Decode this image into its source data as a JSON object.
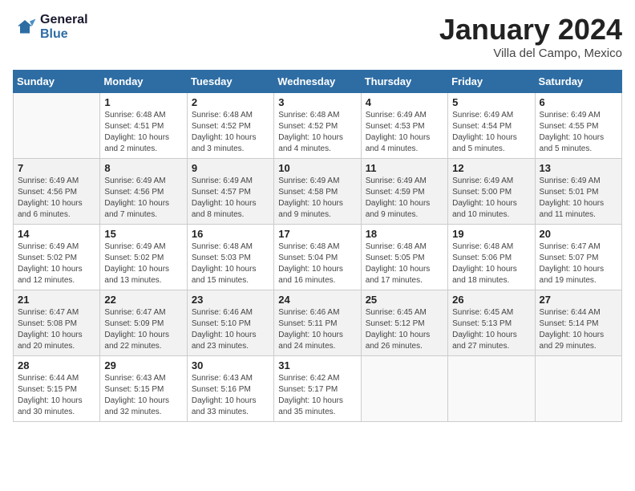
{
  "logo": {
    "line1": "General",
    "line2": "Blue"
  },
  "title": "January 2024",
  "subtitle": "Villa del Campo, Mexico",
  "days_of_week": [
    "Sunday",
    "Monday",
    "Tuesday",
    "Wednesday",
    "Thursday",
    "Friday",
    "Saturday"
  ],
  "weeks": [
    [
      {
        "day": "",
        "info": ""
      },
      {
        "day": "1",
        "info": "Sunrise: 6:48 AM\nSunset: 4:51 PM\nDaylight: 10 hours\nand 2 minutes."
      },
      {
        "day": "2",
        "info": "Sunrise: 6:48 AM\nSunset: 4:52 PM\nDaylight: 10 hours\nand 3 minutes."
      },
      {
        "day": "3",
        "info": "Sunrise: 6:48 AM\nSunset: 4:52 PM\nDaylight: 10 hours\nand 4 minutes."
      },
      {
        "day": "4",
        "info": "Sunrise: 6:49 AM\nSunset: 4:53 PM\nDaylight: 10 hours\nand 4 minutes."
      },
      {
        "day": "5",
        "info": "Sunrise: 6:49 AM\nSunset: 4:54 PM\nDaylight: 10 hours\nand 5 minutes."
      },
      {
        "day": "6",
        "info": "Sunrise: 6:49 AM\nSunset: 4:55 PM\nDaylight: 10 hours\nand 5 minutes."
      }
    ],
    [
      {
        "day": "7",
        "info": "Sunrise: 6:49 AM\nSunset: 4:56 PM\nDaylight: 10 hours\nand 6 minutes."
      },
      {
        "day": "8",
        "info": "Sunrise: 6:49 AM\nSunset: 4:56 PM\nDaylight: 10 hours\nand 7 minutes."
      },
      {
        "day": "9",
        "info": "Sunrise: 6:49 AM\nSunset: 4:57 PM\nDaylight: 10 hours\nand 8 minutes."
      },
      {
        "day": "10",
        "info": "Sunrise: 6:49 AM\nSunset: 4:58 PM\nDaylight: 10 hours\nand 9 minutes."
      },
      {
        "day": "11",
        "info": "Sunrise: 6:49 AM\nSunset: 4:59 PM\nDaylight: 10 hours\nand 9 minutes."
      },
      {
        "day": "12",
        "info": "Sunrise: 6:49 AM\nSunset: 5:00 PM\nDaylight: 10 hours\nand 10 minutes."
      },
      {
        "day": "13",
        "info": "Sunrise: 6:49 AM\nSunset: 5:01 PM\nDaylight: 10 hours\nand 11 minutes."
      }
    ],
    [
      {
        "day": "14",
        "info": "Sunrise: 6:49 AM\nSunset: 5:02 PM\nDaylight: 10 hours\nand 12 minutes."
      },
      {
        "day": "15",
        "info": "Sunrise: 6:49 AM\nSunset: 5:02 PM\nDaylight: 10 hours\nand 13 minutes."
      },
      {
        "day": "16",
        "info": "Sunrise: 6:48 AM\nSunset: 5:03 PM\nDaylight: 10 hours\nand 15 minutes."
      },
      {
        "day": "17",
        "info": "Sunrise: 6:48 AM\nSunset: 5:04 PM\nDaylight: 10 hours\nand 16 minutes."
      },
      {
        "day": "18",
        "info": "Sunrise: 6:48 AM\nSunset: 5:05 PM\nDaylight: 10 hours\nand 17 minutes."
      },
      {
        "day": "19",
        "info": "Sunrise: 6:48 AM\nSunset: 5:06 PM\nDaylight: 10 hours\nand 18 minutes."
      },
      {
        "day": "20",
        "info": "Sunrise: 6:47 AM\nSunset: 5:07 PM\nDaylight: 10 hours\nand 19 minutes."
      }
    ],
    [
      {
        "day": "21",
        "info": "Sunrise: 6:47 AM\nSunset: 5:08 PM\nDaylight: 10 hours\nand 20 minutes."
      },
      {
        "day": "22",
        "info": "Sunrise: 6:47 AM\nSunset: 5:09 PM\nDaylight: 10 hours\nand 22 minutes."
      },
      {
        "day": "23",
        "info": "Sunrise: 6:46 AM\nSunset: 5:10 PM\nDaylight: 10 hours\nand 23 minutes."
      },
      {
        "day": "24",
        "info": "Sunrise: 6:46 AM\nSunset: 5:11 PM\nDaylight: 10 hours\nand 24 minutes."
      },
      {
        "day": "25",
        "info": "Sunrise: 6:45 AM\nSunset: 5:12 PM\nDaylight: 10 hours\nand 26 minutes."
      },
      {
        "day": "26",
        "info": "Sunrise: 6:45 AM\nSunset: 5:13 PM\nDaylight: 10 hours\nand 27 minutes."
      },
      {
        "day": "27",
        "info": "Sunrise: 6:44 AM\nSunset: 5:14 PM\nDaylight: 10 hours\nand 29 minutes."
      }
    ],
    [
      {
        "day": "28",
        "info": "Sunrise: 6:44 AM\nSunset: 5:15 PM\nDaylight: 10 hours\nand 30 minutes."
      },
      {
        "day": "29",
        "info": "Sunrise: 6:43 AM\nSunset: 5:15 PM\nDaylight: 10 hours\nand 32 minutes."
      },
      {
        "day": "30",
        "info": "Sunrise: 6:43 AM\nSunset: 5:16 PM\nDaylight: 10 hours\nand 33 minutes."
      },
      {
        "day": "31",
        "info": "Sunrise: 6:42 AM\nSunset: 5:17 PM\nDaylight: 10 hours\nand 35 minutes."
      },
      {
        "day": "",
        "info": ""
      },
      {
        "day": "",
        "info": ""
      },
      {
        "day": "",
        "info": ""
      }
    ]
  ]
}
